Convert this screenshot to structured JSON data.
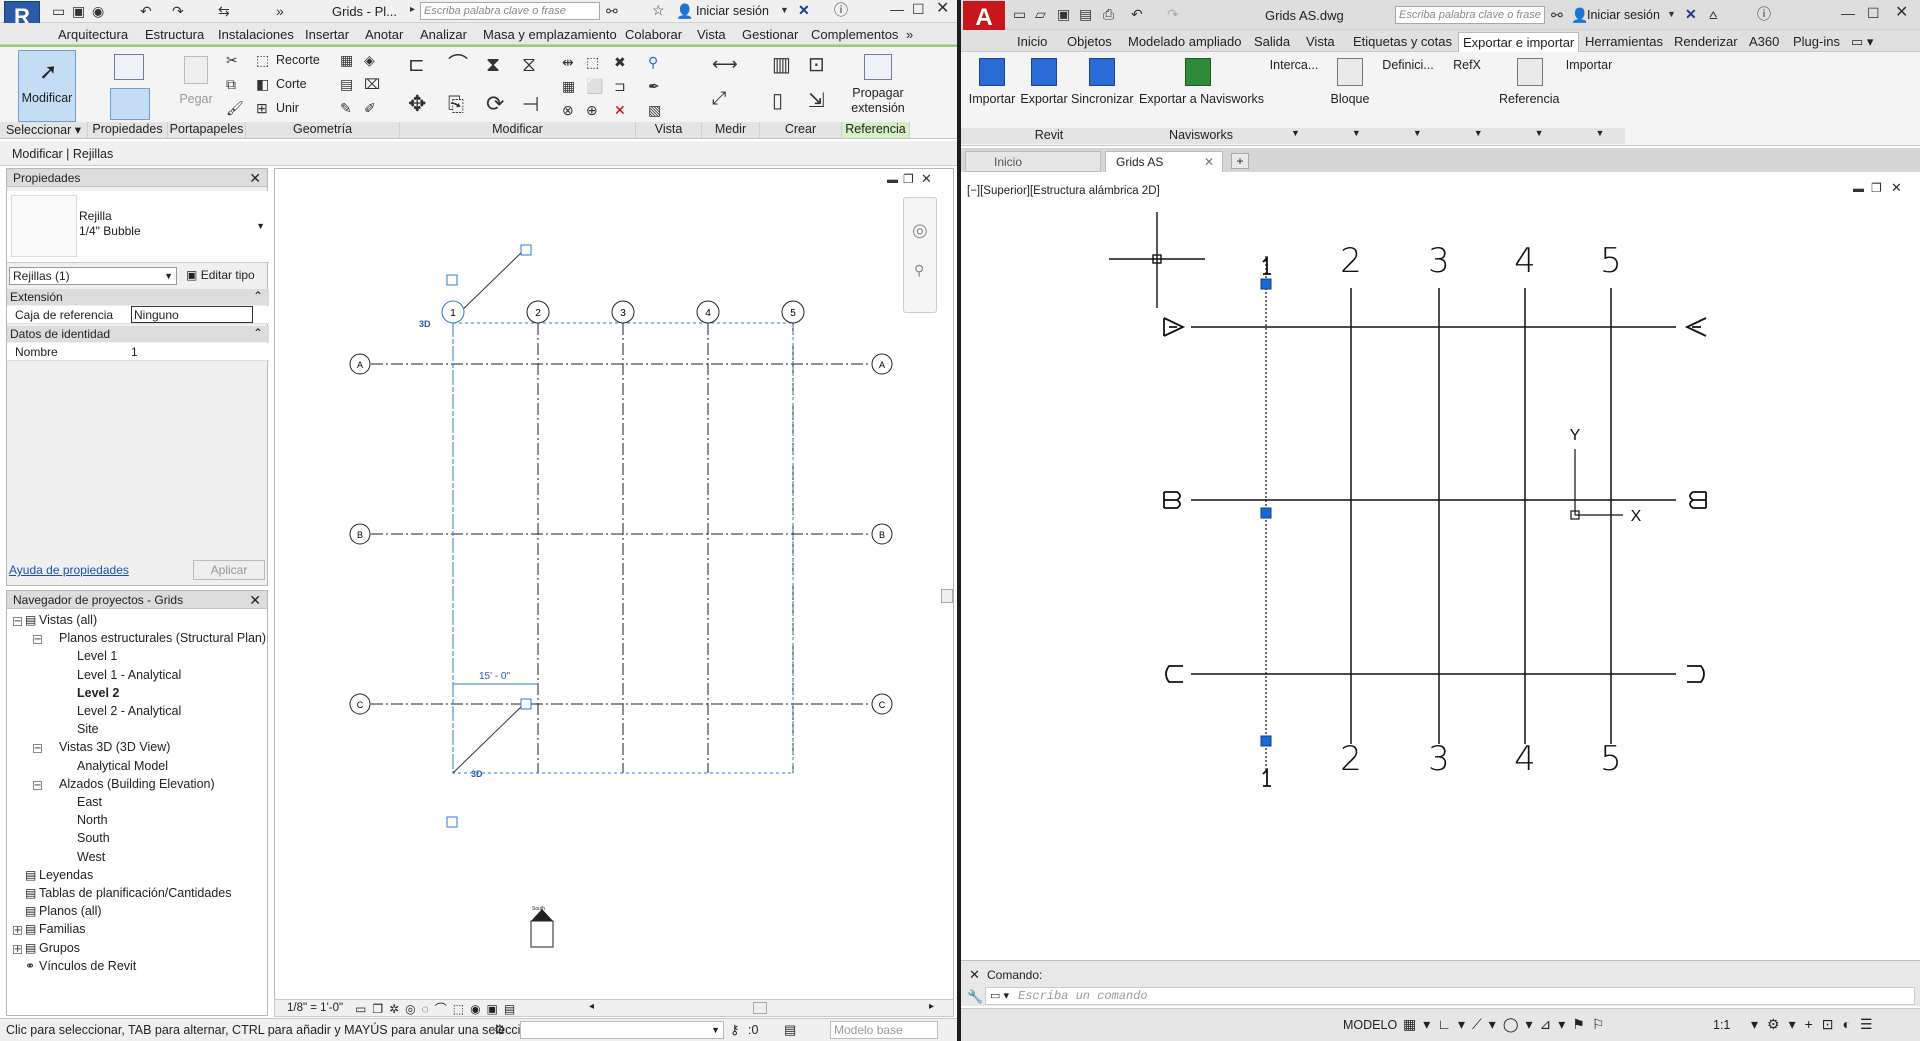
{
  "revit": {
    "title": "Grids - Pl...",
    "search_placeholder": "Escriba palabra clave o frase",
    "signin": "Iniciar sesión",
    "menu": [
      "Arquitectura",
      "Estructura",
      "Instalaciones",
      "Insertar",
      "Anotar",
      "Analizar",
      "Masa y emplazamiento",
      "Colaborar",
      "Vista",
      "Gestionar",
      "Complementos"
    ],
    "ribbon": {
      "modify_label": "Modificar",
      "pegar_label": "Pegar",
      "recorte_label": "Recorte",
      "corte_label": "Corte",
      "unir_label": "Unir",
      "propagar_label": "Propagar extensión",
      "panels": [
        "Seleccionar",
        "Propiedades",
        "Portapapeles",
        "Geometría",
        "Modificar",
        "Vista",
        "Medir",
        "Crear",
        "Referencia"
      ]
    },
    "context_bar": "Modificar | Rejillas",
    "properties": {
      "title": "Propiedades",
      "type_name": "Rejilla",
      "type_sub": "1/4\" Bubble",
      "filter": "Rejillas (1)",
      "edit_type": "Editar tipo",
      "sections": [
        {
          "name": "Extensión",
          "rows": [
            {
              "k": "Caja de referencia",
              "v": "Ninguno"
            }
          ]
        },
        {
          "name": "Datos de identidad",
          "rows": [
            {
              "k": "Nombre",
              "v": "1"
            }
          ]
        }
      ],
      "help_link": "Ayuda de propiedades",
      "apply": "Aplicar"
    },
    "browser": {
      "title": "Navegador de proyectos - Grids",
      "items": [
        {
          "label": "Vistas (all)",
          "level": 0,
          "bold": false
        },
        {
          "label": "Planos estructurales (Structural Plan)",
          "level": 1,
          "bold": false
        },
        {
          "label": "Level 1",
          "level": 2,
          "bold": false
        },
        {
          "label": "Level 1 - Analytical",
          "level": 2,
          "bold": false
        },
        {
          "label": "Level 2",
          "level": 2,
          "bold": true
        },
        {
          "label": "Level 2 - Analytical",
          "level": 2,
          "bold": false
        },
        {
          "label": "Site",
          "level": 2,
          "bold": false
        },
        {
          "label": "Vistas 3D (3D View)",
          "level": 1,
          "bold": false
        },
        {
          "label": "Analytical Model",
          "level": 2,
          "bold": false
        },
        {
          "label": "Alzados (Building Elevation)",
          "level": 1,
          "bold": false
        },
        {
          "label": "East",
          "level": 2,
          "bold": false
        },
        {
          "label": "North",
          "level": 2,
          "bold": false
        },
        {
          "label": "South",
          "level": 2,
          "bold": false
        },
        {
          "label": "West",
          "level": 2,
          "bold": false
        },
        {
          "label": "Leyendas",
          "level": 0,
          "bold": false
        },
        {
          "label": "Tablas de planificación/Cantidades",
          "level": 0,
          "bold": false
        },
        {
          "label": "Planos (all)",
          "level": 0,
          "bold": false
        },
        {
          "label": "Familias",
          "level": 0,
          "bold": false
        },
        {
          "label": "Grupos",
          "level": 0,
          "bold": false
        },
        {
          "label": "Vínculos de Revit",
          "level": 0,
          "bold": false
        }
      ]
    },
    "canvas": {
      "columns": [
        "1",
        "2",
        "3",
        "4",
        "5"
      ],
      "rows": [
        "A",
        "B",
        "C"
      ],
      "dim": "15' - 0\"",
      "tag3d": "3D",
      "south": "South"
    },
    "scale": "1/8\" = 1'-0\"",
    "status_text": "Clic para seleccionar, TAB para alternar, CTRL para añadir y MAYÚS para anular una selecció",
    "status_zero": ":0",
    "model": "Modelo base"
  },
  "acad": {
    "title": "Grids AS.dwg",
    "search_placeholder": "Escriba palabra clave o frase",
    "signin": "Iniciar sesión",
    "menu": [
      "Inicio",
      "Objetos",
      "Modelado ampliado",
      "Salida",
      "Vista",
      "Etiquetas y cotas",
      "Exportar e importar",
      "Herramientas",
      "Renderizar",
      "A360",
      "Plug-ins"
    ],
    "active_menu": "Exportar e importar",
    "ribbon_buttons": [
      "Importar",
      "Exportar",
      "Sincronizar",
      "Exportar a Navisworks",
      "Interca...",
      "Bloque",
      "Definici...",
      "RefX",
      "Referencia",
      "Importar"
    ],
    "ribbon_panels": [
      "Revit",
      "Navisworks"
    ],
    "tabs": [
      "Inicio",
      "Grids AS"
    ],
    "viewport_label": "[−][Superior][Estructura alámbrica 2D]",
    "grid_numbers": [
      "2",
      "3",
      "4",
      "5"
    ],
    "ucs": {
      "y": "Y",
      "x": "X"
    },
    "command_label": "Comando:",
    "command_placeholder": "Escriba un comando",
    "model_label": "MODELO",
    "scale_label": "1:1"
  }
}
